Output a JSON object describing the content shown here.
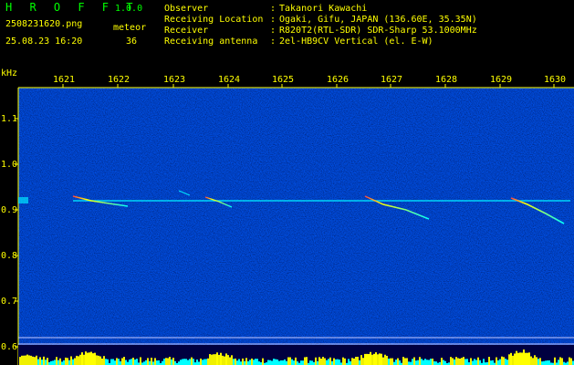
{
  "app": {
    "title": "H R O F F T",
    "version": "1.0.0"
  },
  "file": {
    "name": "2508231620.png",
    "datetime": "25.08.23 16:20"
  },
  "counter": {
    "label": "meteor",
    "value": "36"
  },
  "info": {
    "rows": [
      {
        "key": "Observer",
        "sep": ":",
        "value": "Takanori Kawachi"
      },
      {
        "key": "Receiving Location",
        "sep": ":",
        "value": "Ogaki, Gifu, JAPAN (136.60E, 35.35N)"
      },
      {
        "key": "Receiver",
        "sep": ":",
        "value": "R820T2(RTL-SDR) SDR-Sharp 53.1000MHz"
      },
      {
        "key": "Receiving antenna",
        "sep": ":",
        "value": "2el-HB9CV Vertical (el. E-W)"
      }
    ]
  },
  "axis": {
    "y_unit": "kHz",
    "x_ticks": [
      "1621",
      "1622",
      "1623",
      "1624",
      "1625",
      "1626",
      "1627",
      "1628",
      "1629",
      "1630"
    ],
    "y_ticks": [
      "1.1",
      "1.0",
      "0.9",
      "0.8",
      "0.7",
      "0.6"
    ]
  },
  "colors": {
    "background": "#000000",
    "plot_bg": "#00006e",
    "text": "#ffff00",
    "accent": "#00ff00",
    "signal": "#00ffff"
  }
}
